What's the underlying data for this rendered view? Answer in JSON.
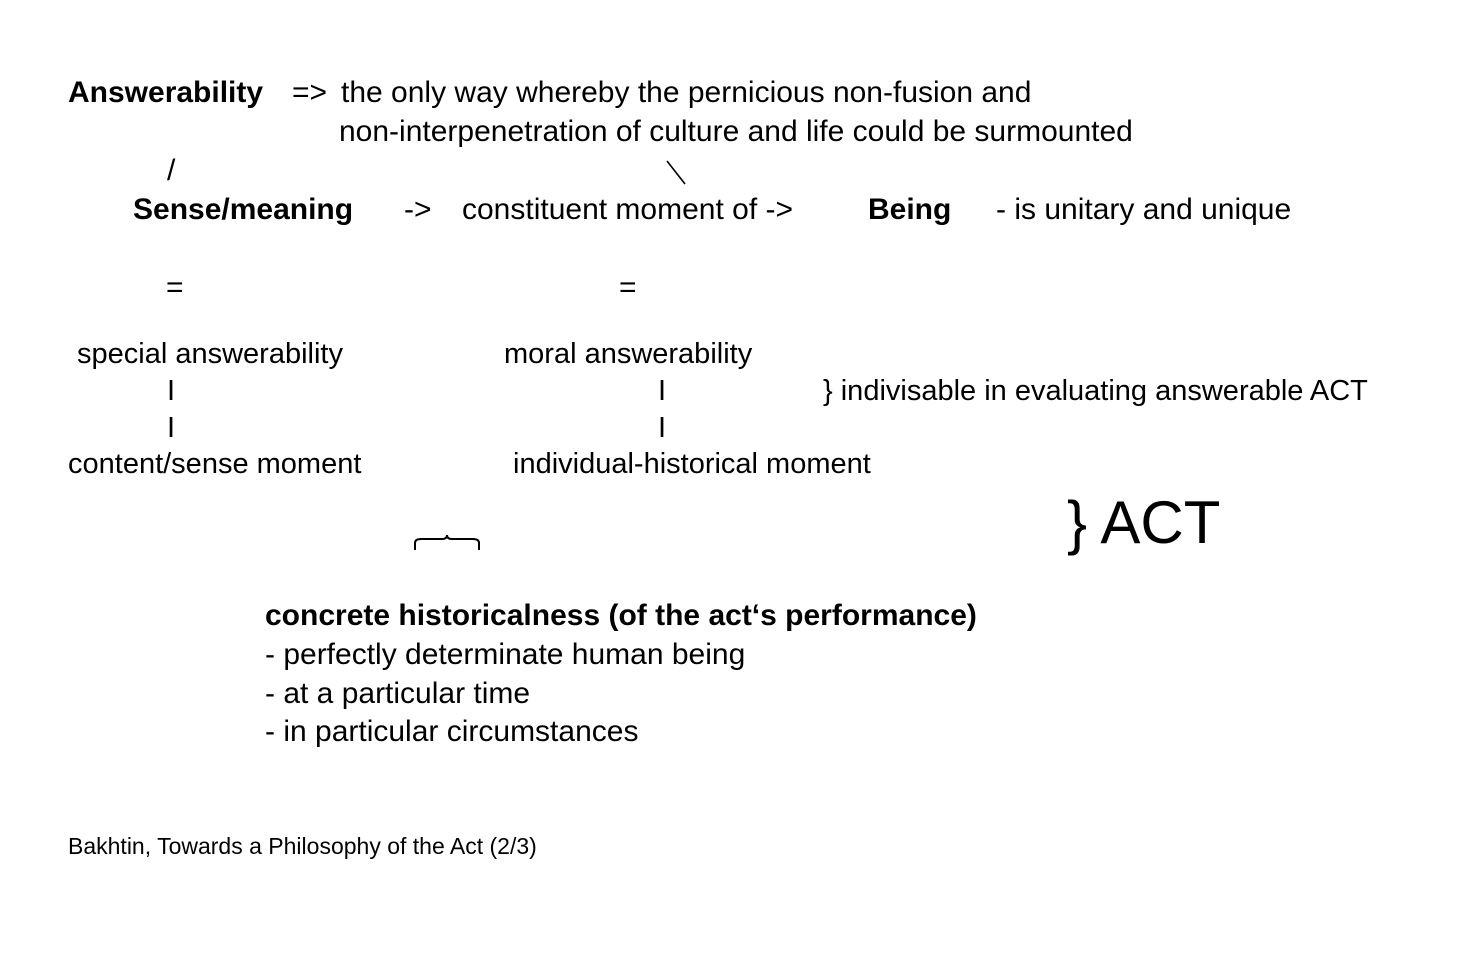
{
  "line1": {
    "term": "Answerability",
    "arrow": "=>",
    "text": "the only way whereby the pernicious non-fusion and"
  },
  "line2": {
    "text": "non-interpenetration of culture and life could be surmounted"
  },
  "branches": {
    "left": "/",
    "right": "\\"
  },
  "row3": {
    "sense": "Sense/meaning",
    "arrow1": "->",
    "constituent": "constituent moment of ->",
    "being": "Being",
    "unitary": "- is unitary and unique"
  },
  "equals": {
    "left": "=",
    "right": "="
  },
  "answerability": {
    "special": "special answerability",
    "moral": "moral answerability",
    "bar": "I",
    "indivisable": "} indivisable in evaluating answerable ACT"
  },
  "moments": {
    "content": "content/sense moment",
    "individual": "individual-historical moment"
  },
  "act": {
    "label": "} ACT"
  },
  "concrete": {
    "title": "concrete historicalness (of the act‘s performance)",
    "items": [
      "- perfectly determinate human being",
      "- at a particular time",
      "- in particular circumstances"
    ]
  },
  "citation": "Bakhtin, Towards a Philosophy of the Act (2/3)"
}
